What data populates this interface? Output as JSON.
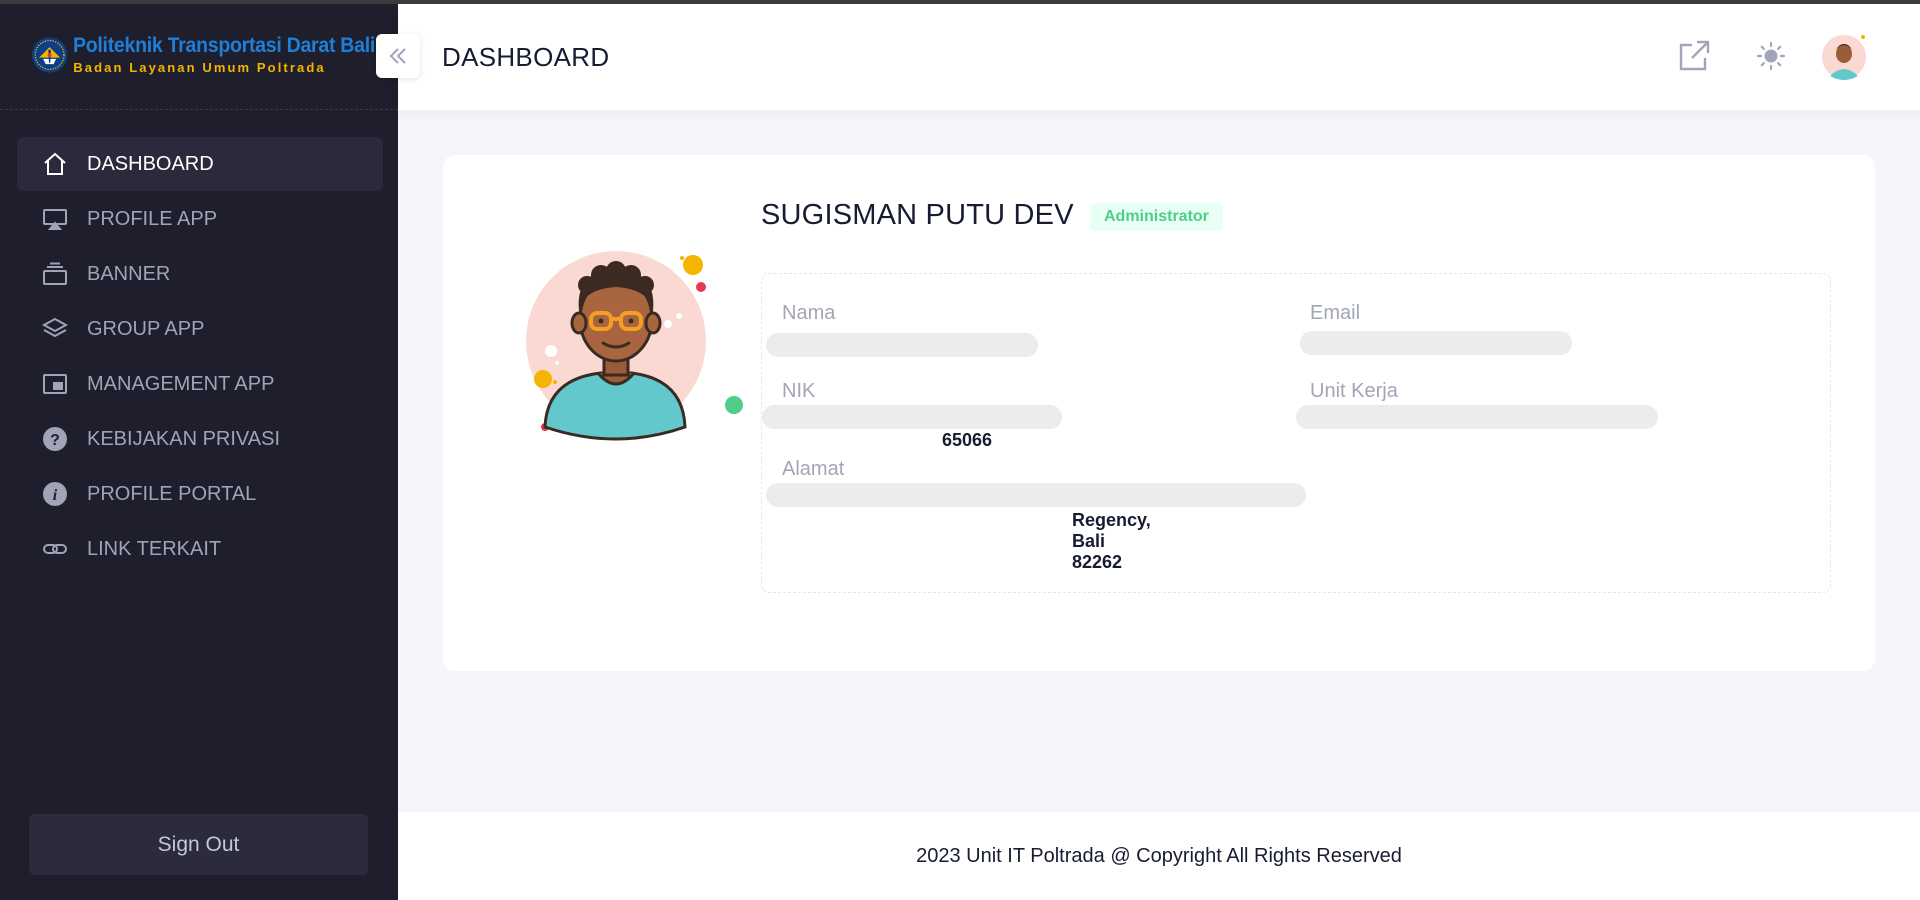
{
  "brand": {
    "title": "Politeknik Transportasi Darat Bali",
    "subtitle": "Badan Layanan Umum Poltrada",
    "logo_icon": "poltrada-emblem-icon"
  },
  "sidebar": {
    "items": [
      {
        "label": "DASHBOARD",
        "icon": "home-icon",
        "active": true
      },
      {
        "label": "PROFILE APP",
        "icon": "airplay-monitor-icon",
        "active": false
      },
      {
        "label": "BANNER",
        "icon": "stack-tray-icon",
        "active": false
      },
      {
        "label": "GROUP APP",
        "icon": "layers-icon",
        "active": false
      },
      {
        "label": "MANAGEMENT APP",
        "icon": "picture-in-picture-icon",
        "active": false
      },
      {
        "label": "KEBIJAKAN PRIVASI",
        "icon": "question-circle-icon",
        "active": false
      },
      {
        "label": "PROFILE PORTAL",
        "icon": "info-circle-icon",
        "active": false
      },
      {
        "label": "LINK TERKAIT",
        "icon": "link-icon",
        "active": false
      }
    ],
    "signout_label": "Sign Out"
  },
  "header": {
    "title": "DASHBOARD",
    "icons": [
      "external-link-icon",
      "sun-icon",
      "user-avatar"
    ]
  },
  "profile": {
    "name": "SUGISMAN PUTU DEV",
    "role": "Administrator",
    "fields": {
      "nama_label": "Nama",
      "email_label": "Email",
      "nik_label": "NIK",
      "unit_label": "Unit Kerja",
      "alamat_label": "Alamat",
      "nik_value": "…65066",
      "alamat_value": "…Regency, Bali 82262"
    }
  },
  "footer": {
    "text": "2023 Unit IT Poltrada @ Copyright All Rights Reserved"
  },
  "colors": {
    "sidebar_bg": "#1e1e2d",
    "active_item_bg": "#2a2a3c",
    "brand_blue": "#1e7fd8",
    "brand_yellow": "#f4b400",
    "badge_green": "#50cd89",
    "page_bg": "#f4f6f9"
  }
}
